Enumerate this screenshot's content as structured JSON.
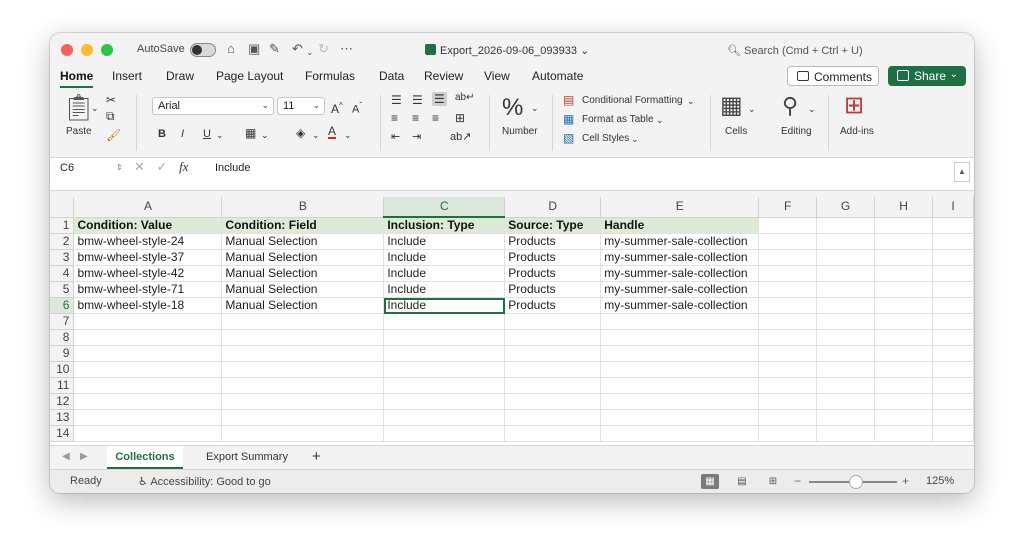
{
  "titlebar": {
    "autosave_label": "AutoSave",
    "doc_title": "Export_2026-09-06_093933",
    "search_placeholder": "Search (Cmd + Ctrl + U)"
  },
  "tabs": [
    "Home",
    "Insert",
    "Draw",
    "Page Layout",
    "Formulas",
    "Data",
    "Review",
    "View",
    "Automate"
  ],
  "active_tab": "Home",
  "actions": {
    "comments": "Comments",
    "share": "Share"
  },
  "ribbon": {
    "paste": "Paste",
    "font_name": "Arial",
    "font_size": "11",
    "bold": "B",
    "italic": "I",
    "underline": "U",
    "number_label": "Number",
    "conditional_formatting": "Conditional Formatting",
    "format_as_table": "Format as Table",
    "cell_styles": "Cell Styles",
    "cells": "Cells",
    "editing": "Editing",
    "addins": "Add-ins"
  },
  "formula_bar": {
    "cell_ref": "C6",
    "fx": "fx",
    "value": "Include"
  },
  "columns": [
    "A",
    "B",
    "C",
    "D",
    "E",
    "F",
    "G",
    "H",
    "I"
  ],
  "sheet": {
    "header_row": [
      "Condition: Value",
      "Condition: Field",
      "Inclusion: Type",
      "Source: Type",
      "Handle"
    ],
    "rows": [
      [
        "bmw-wheel-style-24",
        "Manual Selection",
        "Include",
        "Products",
        "my-summer-sale-collection"
      ],
      [
        "bmw-wheel-style-37",
        "Manual Selection",
        "Include",
        "Products",
        "my-summer-sale-collection"
      ],
      [
        "bmw-wheel-style-42",
        "Manual Selection",
        "Include",
        "Products",
        "my-summer-sale-collection"
      ],
      [
        "bmw-wheel-style-71",
        "Manual Selection",
        "Include",
        "Products",
        "my-summer-sale-collection"
      ],
      [
        "bmw-wheel-style-18",
        "Manual Selection",
        "Include",
        "Products",
        "my-summer-sale-collection"
      ]
    ],
    "row_numbers": [
      "1",
      "2",
      "3",
      "4",
      "5",
      "6",
      "7",
      "8",
      "9",
      "10",
      "11",
      "12",
      "13",
      "14"
    ],
    "selected_cell": "C6"
  },
  "sheet_tabs": [
    "Collections",
    "Export Summary"
  ],
  "active_sheet": "Collections",
  "status": {
    "ready": "Ready",
    "accessibility": "Accessibility: Good to go",
    "zoom": "125%"
  },
  "colors": {
    "accent": "#1d7044",
    "header_fill": "#dcebd5"
  }
}
